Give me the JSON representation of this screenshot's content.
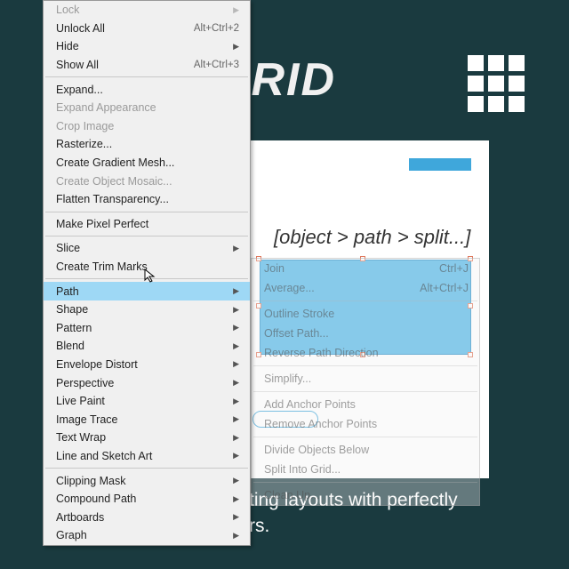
{
  "bg_title": "GRID",
  "breadcrumb": "[object > path > split...]",
  "caption_line1": "ting layouts with perfectly",
  "caption_line2": "rs.",
  "menu": {
    "lock": "Lock",
    "unlock_all": "Unlock All",
    "unlock_all_sc": "Alt+Ctrl+2",
    "hide": "Hide",
    "show_all": "Show All",
    "show_all_sc": "Alt+Ctrl+3",
    "expand": "Expand...",
    "expand_appearance": "Expand Appearance",
    "crop_image": "Crop Image",
    "rasterize": "Rasterize...",
    "create_gradient_mesh": "Create Gradient Mesh...",
    "create_object_mosaic": "Create Object Mosaic...",
    "flatten_transparency": "Flatten Transparency...",
    "make_pixel_perfect": "Make Pixel Perfect",
    "slice": "Slice",
    "create_trim_marks": "Create Trim Marks",
    "path": "Path",
    "shape": "Shape",
    "pattern": "Pattern",
    "blend": "Blend",
    "envelope_distort": "Envelope Distort",
    "perspective": "Perspective",
    "live_paint": "Live Paint",
    "image_trace": "Image Trace",
    "text_wrap": "Text Wrap",
    "line_sketch_art": "Line and Sketch Art",
    "clipping_mask": "Clipping Mask",
    "compound_path": "Compound Path",
    "artboards": "Artboards",
    "graph": "Graph"
  },
  "submenu": {
    "join": "Join",
    "join_sc": "Ctrl+J",
    "average": "Average...",
    "average_sc": "Alt+Ctrl+J",
    "outline_stroke": "Outline Stroke",
    "offset_path": "Offset Path...",
    "reverse_path": "Reverse Path Direction",
    "simplify": "Simplify...",
    "add_anchor": "Add Anchor Points",
    "remove_anchor": "Remove Anchor Points",
    "divide_below": "Divide Objects Below",
    "split_grid": "Split Into Grid...",
    "clean_up": "Clean Up..."
  }
}
